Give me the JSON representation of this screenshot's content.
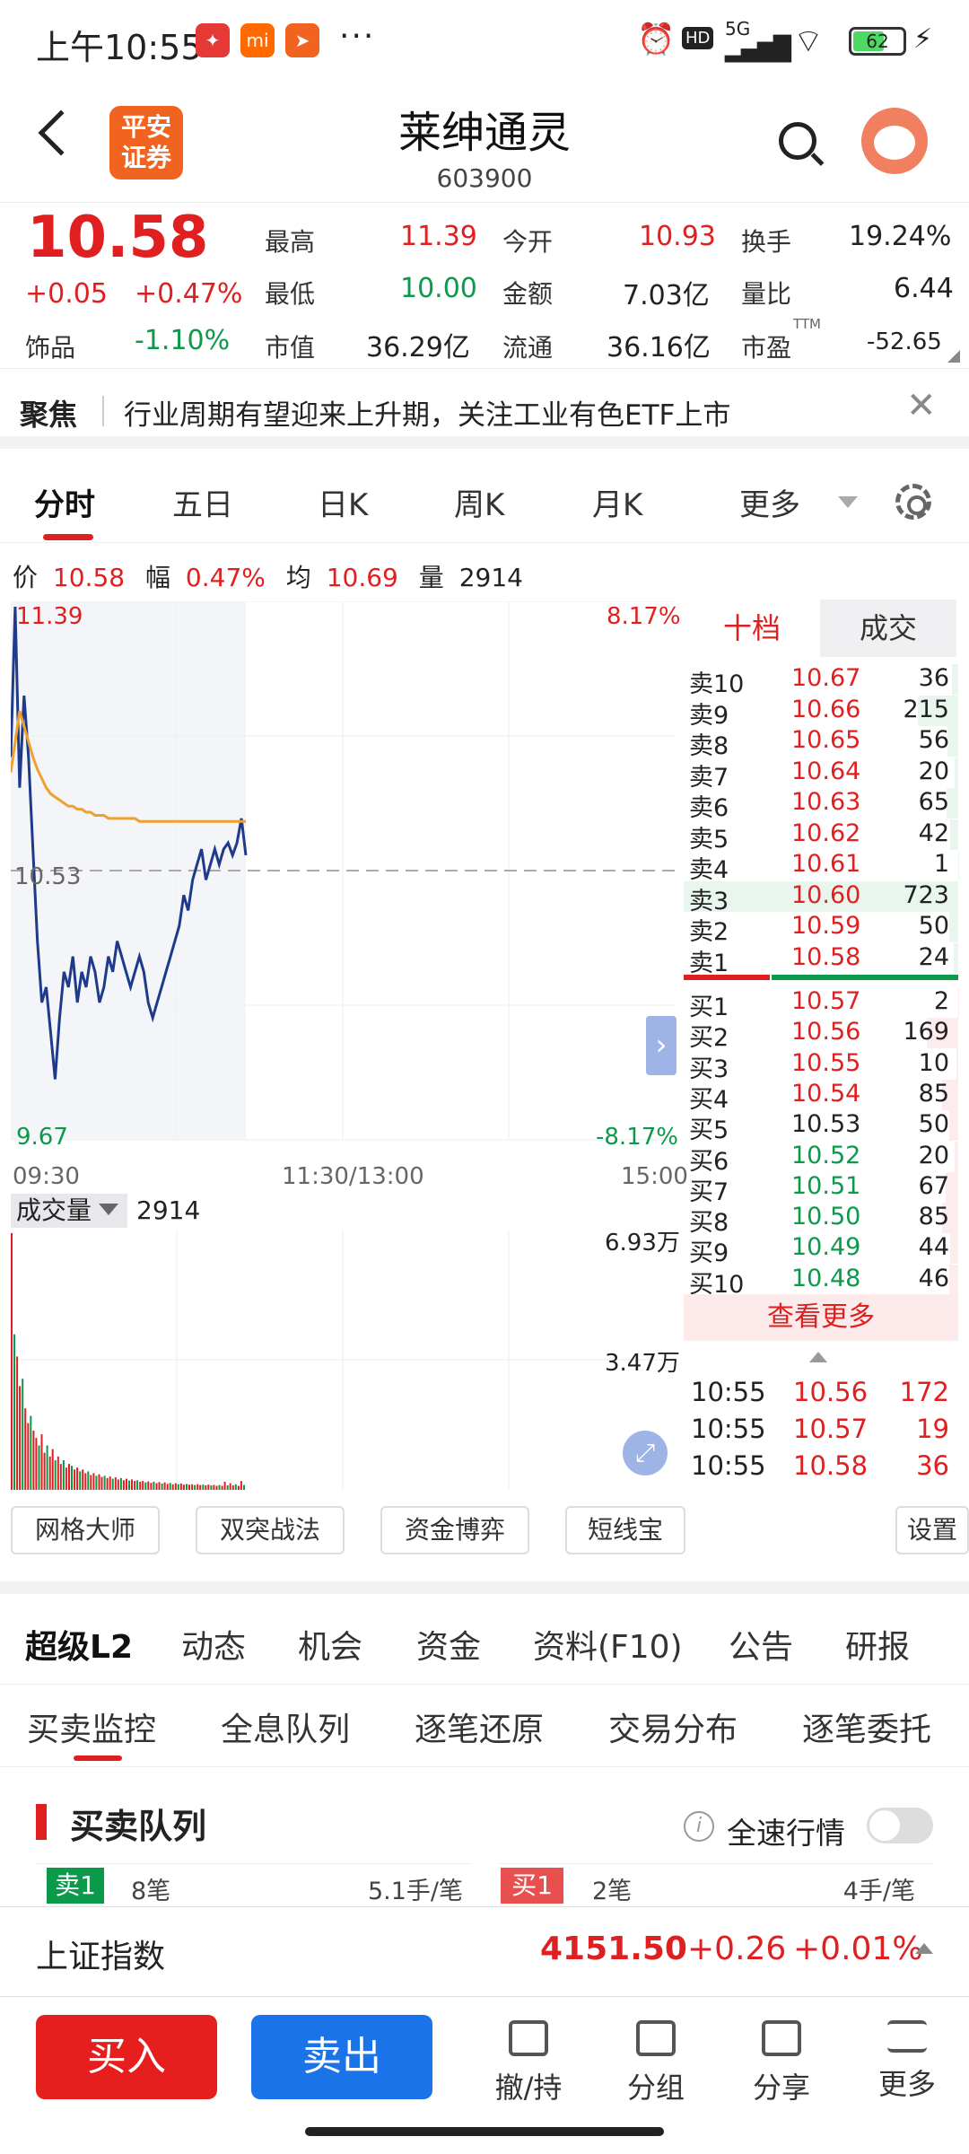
{
  "status_bar": {
    "time": "上午10:55",
    "network": "5G",
    "battery": "62",
    "more": "···"
  },
  "header": {
    "logo_line1": "平安",
    "logo_line2": "证券",
    "stock_name": "莱绅通灵",
    "stock_code": "603900"
  },
  "quote": {
    "price": "10.58",
    "change": "+0.05",
    "change_pct": "+0.47%",
    "sector_label": "饰品",
    "sector_pct": "-1.10%",
    "high_label": "最高",
    "high": "11.39",
    "low_label": "最低",
    "low": "10.00",
    "mcap_label": "市值",
    "mcap": "36.29亿",
    "open_label": "今开",
    "open": "10.93",
    "amount_label": "金额",
    "amount": "7.03亿",
    "float_label": "流通",
    "float": "36.16亿",
    "turnover_label": "换手",
    "turnover": "19.24%",
    "volratio_label": "量比",
    "volratio": "6.44",
    "pe_label": "市盈",
    "pe_sup": "TTM",
    "pe": "-52.65"
  },
  "focus": {
    "tag": "聚焦",
    "text": "行业周期有望迎来上升期，关注工业有色ETF上市"
  },
  "chart_tabs": [
    "分时",
    "五日",
    "日K",
    "周K",
    "月K",
    "更多"
  ],
  "info_line": {
    "price_label": "价",
    "price": "10.58",
    "amp_label": "幅",
    "amp": "0.47%",
    "avg_label": "均",
    "avg": "10.69",
    "vol_label": "量",
    "vol": "2914"
  },
  "chart_data": [
    {
      "type": "line",
      "title": "",
      "x_labels": [
        "09:30",
        "11:30/13:00",
        "15:00"
      ],
      "ylim": [
        9.67,
        11.39
      ],
      "y_labels": {
        "top": "11.39",
        "bottom": "9.67",
        "ref": "10.53",
        "top_pct": "8.17%",
        "bottom_pct": "-8.17%"
      },
      "prev_close": 10.53,
      "series": [
        {
          "name": "",
          "color": "#1f3a8a",
          "values": [
            10.9,
            11.39,
            10.8,
            11.1,
            10.9,
            10.6,
            10.3,
            10.1,
            10.15,
            10.0,
            9.85,
            10.05,
            10.2,
            10.15,
            10.25,
            10.1,
            10.2,
            10.15,
            10.25,
            10.2,
            10.1,
            10.15,
            10.25,
            10.2,
            10.3,
            10.25,
            10.2,
            10.15,
            10.2,
            10.25,
            10.2,
            10.1,
            10.05,
            10.1,
            10.15,
            10.2,
            10.25,
            10.3,
            10.35,
            10.45,
            10.4,
            10.5,
            10.55,
            10.6,
            10.5,
            10.55,
            10.6,
            10.55,
            10.6,
            10.62,
            10.58,
            10.62,
            10.7,
            10.58
          ]
        },
        {
          "name": "",
          "color": "#f0a030",
          "values": [
            10.85,
            10.95,
            11.05,
            11.0,
            10.95,
            10.9,
            10.86,
            10.83,
            10.8,
            10.78,
            10.77,
            10.76,
            10.75,
            10.74,
            10.74,
            10.73,
            10.73,
            10.72,
            10.72,
            10.71,
            10.71,
            10.71,
            10.7,
            10.7,
            10.7,
            10.7,
            10.7,
            10.7,
            10.7,
            10.69,
            10.69,
            10.69,
            10.69,
            10.69,
            10.69,
            10.69,
            10.69,
            10.69,
            10.69,
            10.69,
            10.69,
            10.69,
            10.69,
            10.69,
            10.69,
            10.69,
            10.69,
            10.69,
            10.69,
            10.69,
            10.69,
            10.69,
            10.69,
            10.69
          ]
        }
      ]
    },
    {
      "type": "bar",
      "title": "",
      "volume_label": "成交量",
      "volume_value": "2914",
      "y_labels": {
        "max": "6.93万",
        "mid": "3.47万"
      },
      "ylim": [
        0,
        69300
      ],
      "values": [
        69300,
        42000,
        36000,
        28000,
        30000,
        22000,
        18000,
        20000,
        16000,
        14000,
        12000,
        15000,
        10000,
        12000,
        9000,
        11000,
        8000,
        9000,
        7000,
        8000,
        6000,
        7000,
        6500,
        5500,
        6000,
        5000,
        5500,
        4500,
        5000,
        4000,
        4500,
        3800,
        4200,
        3500,
        3800,
        3200,
        3600,
        3000,
        3400,
        2800,
        3200,
        2600,
        3000,
        2500,
        2800,
        2400,
        2600,
        2200,
        2400,
        2000,
        2300,
        1900,
        2200,
        1800,
        2100,
        1700,
        2000,
        1600,
        1900,
        1500,
        1800,
        1500,
        1700,
        1400,
        1600,
        1400,
        1500,
        1300,
        1500,
        1300,
        1400,
        1200,
        1400,
        1200,
        1300,
        1100,
        1300,
        1100,
        2200,
        1200,
        1800,
        1200,
        1500,
        1100,
        2400,
        1300
      ]
    }
  ],
  "orderbook": {
    "tab_levels": "十档",
    "tab_trades": "成交",
    "asks": [
      {
        "label": "卖10",
        "price": "10.67",
        "qty": "36"
      },
      {
        "label": "卖9",
        "price": "10.66",
        "qty": "215"
      },
      {
        "label": "卖8",
        "price": "10.65",
        "qty": "56"
      },
      {
        "label": "卖7",
        "price": "10.64",
        "qty": "20"
      },
      {
        "label": "卖6",
        "price": "10.63",
        "qty": "65"
      },
      {
        "label": "卖5",
        "price": "10.62",
        "qty": "42"
      },
      {
        "label": "卖4",
        "price": "10.61",
        "qty": "1"
      },
      {
        "label": "卖3",
        "price": "10.60",
        "qty": "723"
      },
      {
        "label": "卖2",
        "price": "10.59",
        "qty": "50"
      },
      {
        "label": "卖1",
        "price": "10.58",
        "qty": "24"
      }
    ],
    "bids": [
      {
        "label": "买1",
        "price": "10.57",
        "qty": "2"
      },
      {
        "label": "买2",
        "price": "10.56",
        "qty": "169"
      },
      {
        "label": "买3",
        "price": "10.55",
        "qty": "10"
      },
      {
        "label": "买4",
        "price": "10.54",
        "qty": "85"
      },
      {
        "label": "买5",
        "price": "10.53",
        "qty": "50"
      },
      {
        "label": "买6",
        "price": "10.52",
        "qty": "20"
      },
      {
        "label": "买7",
        "price": "10.51",
        "qty": "67"
      },
      {
        "label": "买8",
        "price": "10.50",
        "qty": "85"
      },
      {
        "label": "买9",
        "price": "10.49",
        "qty": "44"
      },
      {
        "label": "买10",
        "price": "10.48",
        "qty": "46"
      }
    ],
    "more": "查看更多",
    "trades": [
      {
        "time": "10:55",
        "price": "10.56",
        "qty": "172"
      },
      {
        "time": "10:55",
        "price": "10.57",
        "qty": "19"
      },
      {
        "time": "10:55",
        "price": "10.58",
        "qty": "36"
      }
    ]
  },
  "tools": [
    "网格大师",
    "双突战法",
    "资金博弈",
    "短线宝",
    "设置"
  ],
  "l2_tabs": [
    "超级L2",
    "动态",
    "机会",
    "资金",
    "资料(F10)",
    "公告",
    "研报"
  ],
  "sub_tabs": [
    "买卖监控",
    "全息队列",
    "逐笔还原",
    "交易分布",
    "逐笔委托"
  ],
  "queue": {
    "title": "买卖队列",
    "fullspeed": "全速行情",
    "sell_badge": "卖1",
    "sell_count": "8笔",
    "sell_avg": "5.1手/笔",
    "buy_badge": "买1",
    "buy_count": "2笔",
    "buy_avg": "4手/笔"
  },
  "index_bar": {
    "name": "上证指数",
    "value": "4151.50",
    "change": "+0.26",
    "pct": "+0.01%"
  },
  "bottom_nav": {
    "buy": "买入",
    "sell": "卖出",
    "cancel": "撤/持",
    "group": "分组",
    "share": "分享",
    "more": "更多"
  },
  "colors": {
    "up": "#e02020",
    "down": "#0a9a4a",
    "accent": "#e02020",
    "sell_button": "#1a73e8"
  }
}
